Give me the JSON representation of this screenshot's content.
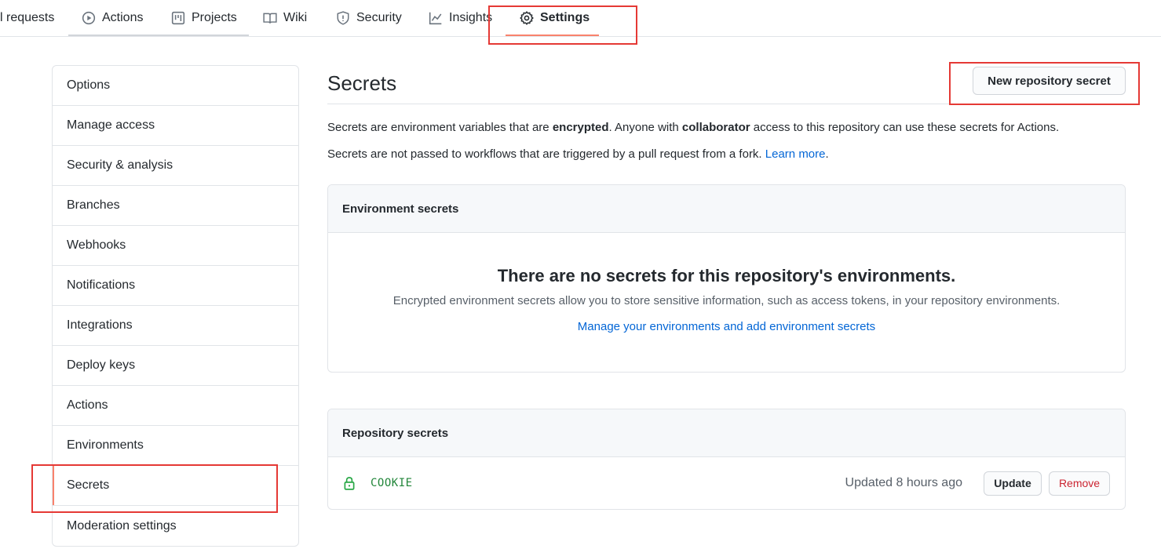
{
  "nav": {
    "tabs": [
      {
        "label": "l requests",
        "icon": "pull-request-icon"
      },
      {
        "label": "Actions",
        "icon": "play-icon"
      },
      {
        "label": "Projects",
        "icon": "project-icon"
      },
      {
        "label": "Wiki",
        "icon": "book-icon"
      },
      {
        "label": "Security",
        "icon": "shield-icon"
      },
      {
        "label": "Insights",
        "icon": "graph-icon"
      },
      {
        "label": "Settings",
        "icon": "gear-icon",
        "selected": true
      }
    ]
  },
  "sidebar": {
    "items": [
      {
        "label": "Options"
      },
      {
        "label": "Manage access"
      },
      {
        "label": "Security & analysis"
      },
      {
        "label": "Branches"
      },
      {
        "label": "Webhooks"
      },
      {
        "label": "Notifications"
      },
      {
        "label": "Integrations"
      },
      {
        "label": "Deploy keys"
      },
      {
        "label": "Actions"
      },
      {
        "label": "Environments"
      },
      {
        "label": "Secrets",
        "selected": true
      },
      {
        "label": "Moderation settings"
      }
    ]
  },
  "main": {
    "title": "Secrets",
    "new_button": "New repository secret",
    "desc1": {
      "part1": "Secrets are environment variables that are ",
      "bold1": "encrypted",
      "part2": ". Anyone with ",
      "bold2": "collaborator",
      "part3": " access to this repository can use these secrets for Actions."
    },
    "desc2": {
      "text": "Secrets are not passed to workflows that are triggered by a pull request from a fork. ",
      "link": "Learn more",
      "end": "."
    },
    "environment_secrets": {
      "header": "Environment secrets",
      "blank_title": "There are no secrets for this repository's environments.",
      "blank_desc": "Encrypted environment secrets allow you to store sensitive information, such as access tokens, in your repository environments.",
      "blank_link": "Manage your environments and add environment secrets"
    },
    "repository_secrets": {
      "header": "Repository secrets",
      "rows": [
        {
          "name": "COOKIE",
          "updated": "Updated 8 hours ago",
          "update_label": "Update",
          "remove_label": "Remove"
        }
      ]
    }
  },
  "colors": {
    "accent_underline": "#f9826c",
    "link": "#0366d6",
    "secret_green": "#22863a",
    "danger": "#cb2431",
    "annotation": "#e53935"
  }
}
